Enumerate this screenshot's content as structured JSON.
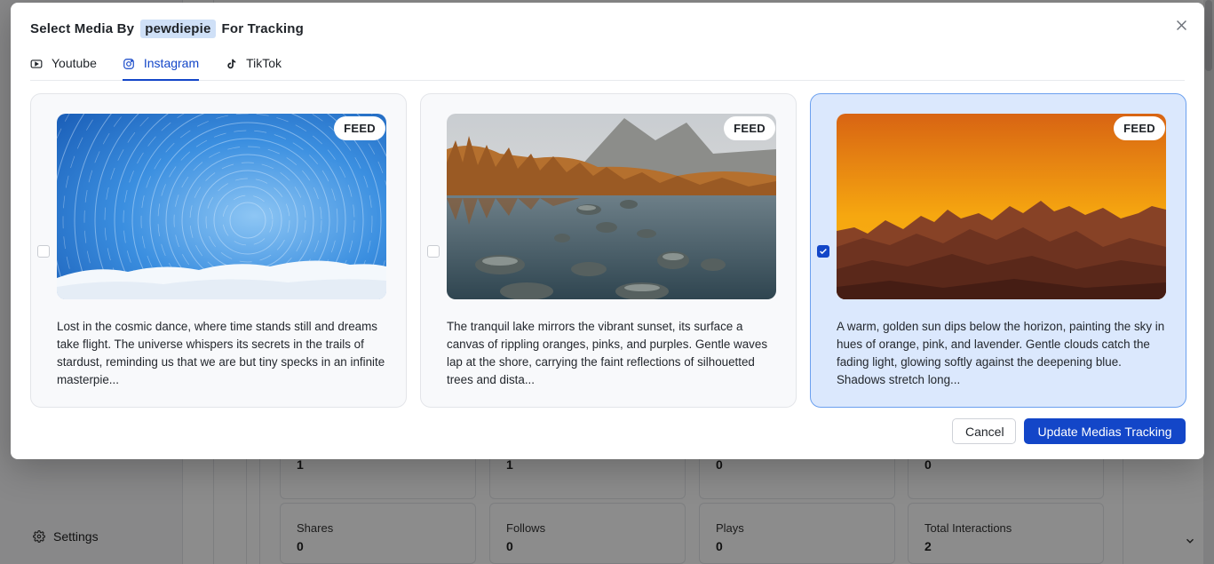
{
  "background": {
    "settings_label": "Settings",
    "stats_row_top": [
      {
        "value": "1"
      },
      {
        "value": "1"
      },
      {
        "value": "0"
      },
      {
        "value": "0"
      }
    ],
    "stats_row_bottom": [
      {
        "label": "Shares",
        "value": "0"
      },
      {
        "label": "Follows",
        "value": "0"
      },
      {
        "label": "Plays",
        "value": "0"
      },
      {
        "label": "Total Interactions",
        "value": "2"
      }
    ]
  },
  "modal": {
    "title_prefix": "Select Media By",
    "username": "pewdiepie",
    "title_suffix": "For Tracking",
    "tabs": [
      {
        "label": "Youtube",
        "icon": "youtube-icon",
        "active": false
      },
      {
        "label": "Instagram",
        "icon": "instagram-icon",
        "active": true
      },
      {
        "label": "TikTok",
        "icon": "tiktok-icon",
        "active": false
      }
    ],
    "cards": [
      {
        "badge": "FEED",
        "image": "star-trails-sky",
        "checked": false,
        "caption": "Lost in the cosmic dance, where time stands still and dreams take flight. The universe whispers its secrets in the trails of stardust, reminding us that we are but tiny specks in an infinite masterpie..."
      },
      {
        "badge": "FEED",
        "image": "autumn-lake-reflection",
        "checked": false,
        "caption": "The tranquil lake mirrors the vibrant sunset, its surface a canvas of rippling oranges, pinks, and purples. Gentle waves lap at the shore, carrying the faint reflections of silhouetted trees and dista..."
      },
      {
        "badge": "FEED",
        "image": "orange-mountain-sunset",
        "checked": true,
        "caption": "A warm, golden sun dips below the horizon, painting the sky in hues of orange, pink, and lavender. Gentle clouds catch the fading light, glowing softly against the deepening blue. Shadows stretch long..."
      }
    ],
    "cancel_label": "Cancel",
    "submit_label": "Update Medias Tracking"
  },
  "colors": {
    "accent": "#1346c8",
    "selected_card_bg": "#dbe8fd",
    "username_chip": "#cfe0f7"
  }
}
